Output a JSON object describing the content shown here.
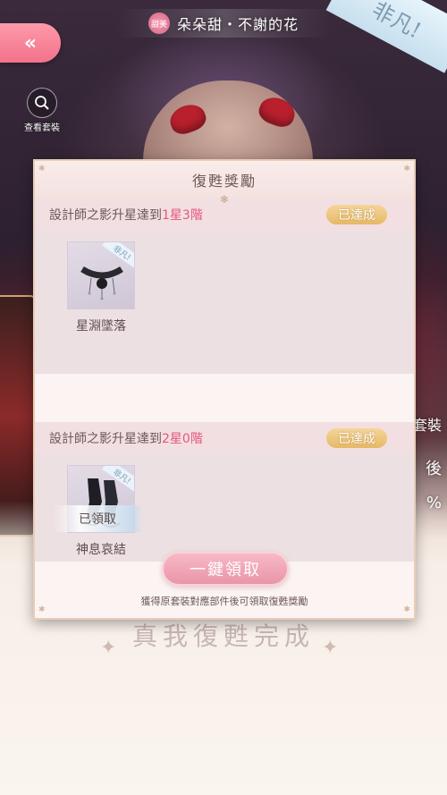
{
  "header": {
    "back_icon": "double-chevron-left-icon",
    "rarity_badge": "甜美",
    "title": "朵朵甜・不謝的花",
    "corner_tag": "非凡!"
  },
  "view_outfit": {
    "icon": "search-icon",
    "label": "查看套裝"
  },
  "dialog": {
    "title": "復甦獎勵",
    "sections": [
      {
        "prefix": "設計師之影升星達到",
        "highlight": "1星3階",
        "status": "已達成",
        "items": [
          {
            "name": "星淵墜落",
            "tag": "非凡!",
            "claimed_label": "已領取"
          }
        ]
      },
      {
        "prefix": "設計師之影升星達到",
        "highlight": "2星0階",
        "status": "已達成",
        "items": [
          {
            "name": "神息哀結",
            "tag": "非凡!"
          }
        ]
      }
    ],
    "claim_all_button": "一鍵領取",
    "hint": "獲得原套裝對應部件後可領取復甦獎勵"
  },
  "background": {
    "under_text": "真我復甦完成",
    "right_hints": [
      "套裝",
      "後",
      "%"
    ]
  }
}
